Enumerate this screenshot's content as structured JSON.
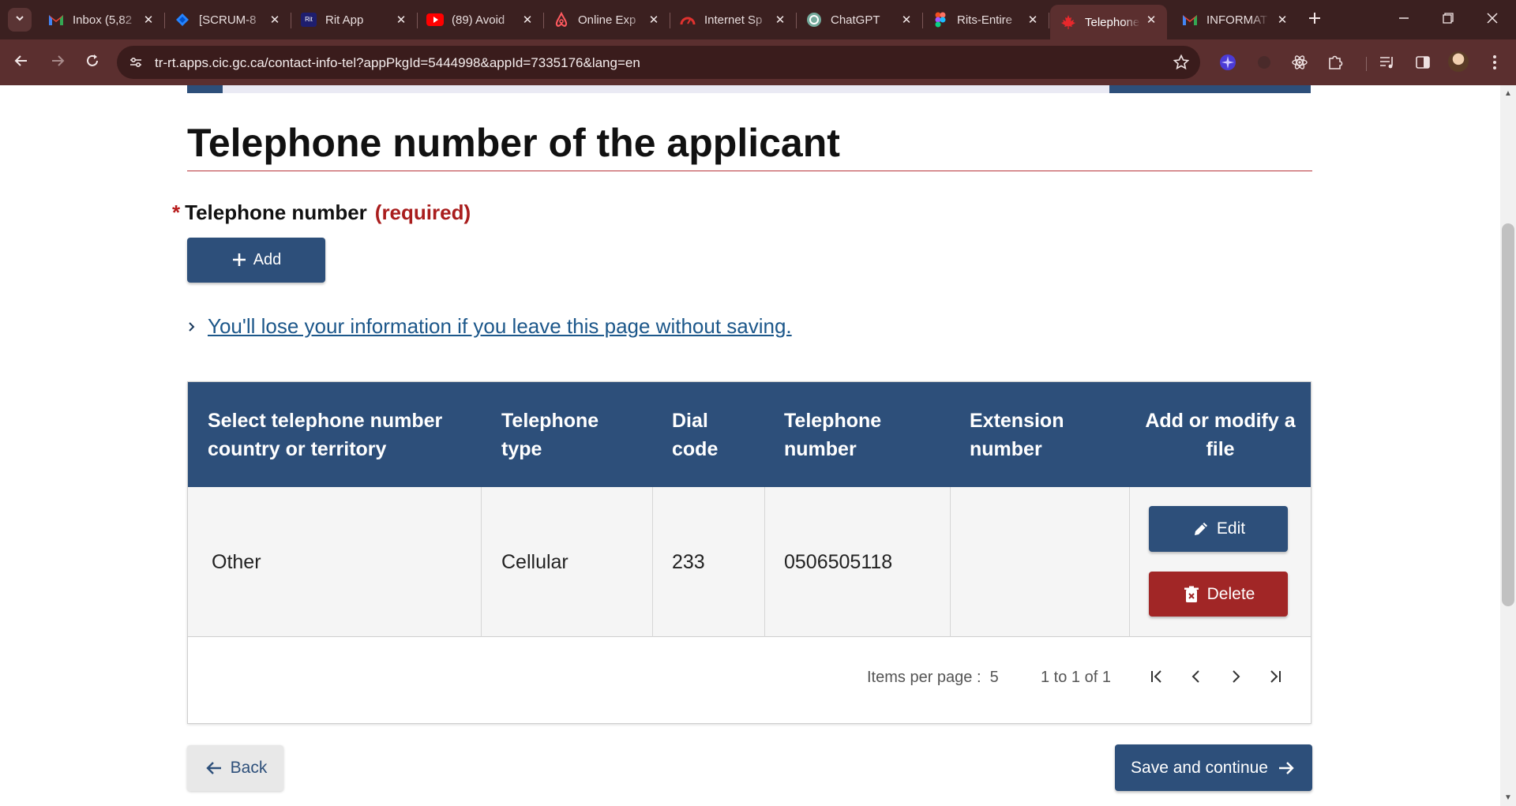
{
  "browser": {
    "tabs": [
      {
        "title": "Inbox (5,82",
        "icon": "gmail-icon"
      },
      {
        "title": "[SCRUM-8",
        "icon": "jira-icon"
      },
      {
        "title": "Rit App",
        "icon": "rit-app-icon",
        "icon_text": "Rit"
      },
      {
        "title": "(89) Avoid",
        "icon": "youtube-icon"
      },
      {
        "title": "Online Exp",
        "icon": "airbnb-icon"
      },
      {
        "title": "Internet Sp",
        "icon": "speedtest-icon"
      },
      {
        "title": "ChatGPT",
        "icon": "chatgpt-icon"
      },
      {
        "title": "Rits-Entire",
        "icon": "figma-icon"
      },
      {
        "title": "Telephone",
        "icon": "maple-leaf-icon",
        "active": true
      },
      {
        "title": "INFORMAT",
        "icon": "gmail-icon"
      }
    ],
    "url": "tr-rt.apps.cic.gc.ca/contact-info-tel?appPkgId=5444998&appId=7335176&lang=en",
    "theme_color": "#5b2f2f"
  },
  "page": {
    "title": "Telephone number of the applicant",
    "field_label": "Telephone number",
    "required_mark": "*",
    "required_text": "(required)",
    "add_button": "Add",
    "warning_link": "You'll lose your information if you leave this page without saving.",
    "primary_color": "#2d4f7a",
    "danger_color": "#a12626"
  },
  "table": {
    "headers": [
      "Select telephone number country or territory",
      "Telephone type",
      "Dial code",
      "Telephone number",
      "Extension number",
      "Add or modify a file"
    ],
    "rows": [
      {
        "country": "Other",
        "type": "Cellular",
        "dial_code": "233",
        "number": "0506505118",
        "extension": "",
        "edit_label": "Edit",
        "delete_label": "Delete"
      }
    ]
  },
  "pagination": {
    "items_per_page_label": "Items per page :",
    "items_per_page_value": "5",
    "range": "1 to 1 of 1"
  },
  "footer": {
    "back": "Back",
    "save": "Save and continue"
  }
}
